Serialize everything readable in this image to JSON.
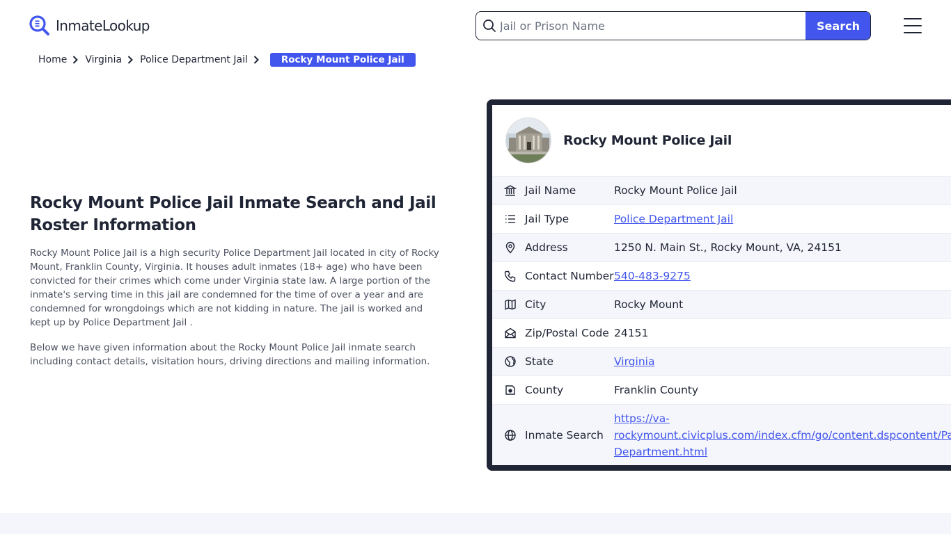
{
  "header": {
    "logo_text": "InmateLookup",
    "search_placeholder": "Jail or Prison Name",
    "search_button": "Search"
  },
  "breadcrumb": {
    "items": [
      "Home",
      "Virginia",
      "Police Department Jail"
    ],
    "active": "Rocky Mount Police Jail"
  },
  "main": {
    "heading": "Rocky Mount Police Jail Inmate Search and Jail Roster Information",
    "paragraph1": "Rocky Mount Police Jail is a high security Police Department Jail located in city of Rocky Mount, Franklin County, Virginia. It houses adult inmates (18+ age) who have been convicted for their crimes which come under Virginia state law. A large portion of the inmate's serving time in this jail are condemned for the time of over a year and are condemned for wrongdoings which are not kidding in nature. The jail is worked and kept up by Police Department Jail .",
    "paragraph2": "Below we have given information about the Rocky Mount Police Jail inmate search including contact details, visitation hours, driving directions and mailing information."
  },
  "card": {
    "title": "Rocky Mount Police Jail",
    "rows": [
      {
        "icon": "bank-icon",
        "label": "Jail Name",
        "value": "Rocky Mount Police Jail",
        "link": false
      },
      {
        "icon": "list-icon",
        "label": "Jail Type",
        "value": "Police Department Jail",
        "link": true
      },
      {
        "icon": "map-pin-icon",
        "label": "Address",
        "value": "1250 N. Main St., Rocky Mount, VA, 24151",
        "link": false
      },
      {
        "icon": "phone-icon",
        "label": "Contact Number",
        "value": "540-483-9275",
        "link": true
      },
      {
        "icon": "map-icon",
        "label": "City",
        "value": "Rocky Mount",
        "link": false
      },
      {
        "icon": "mail-icon",
        "label": "Zip/Postal Code",
        "value": "24151",
        "link": false
      },
      {
        "icon": "globe-icon",
        "label": "State",
        "value": "Virginia",
        "link": true
      },
      {
        "icon": "region-icon",
        "label": "County",
        "value": "Franklin County",
        "link": false
      },
      {
        "icon": "world-icon",
        "label": "Inmate Search",
        "value": "https://va-rockymount.civicplus.com/index.cfm/go/content.dspcontent/Page/Police-Department.html",
        "value_lines": [
          "https://va-",
          "rockymount.civicplus.com/index.cfm/go/content.dspcontent/Pag",
          "Department.html"
        ],
        "link": true
      }
    ]
  },
  "colors": {
    "accent": "#4256ee",
    "text": "#1f2535",
    "muted": "#4b5160",
    "row_alt": "#f5f6fb"
  }
}
